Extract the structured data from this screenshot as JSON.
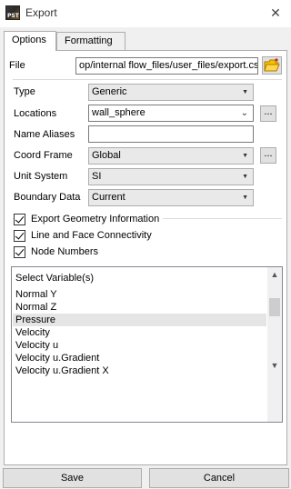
{
  "window": {
    "title": "Export",
    "icon_text": "PST",
    "close_glyph": "✕"
  },
  "tabs": [
    {
      "label": "Options",
      "active": true
    },
    {
      "label": "Formatting",
      "active": false
    }
  ],
  "file": {
    "label": "File",
    "value": "op/internal flow_files/user_files/export.csv",
    "browse_icon": "folder-open-icon"
  },
  "form": {
    "type": {
      "label": "Type",
      "value": "Generic"
    },
    "locations": {
      "label": "Locations",
      "value": "wall_sphere",
      "more_button": "..."
    },
    "name_aliases": {
      "label": "Name Aliases",
      "value": ""
    },
    "coord_frame": {
      "label": "Coord Frame",
      "value": "Global",
      "more_button": "..."
    },
    "unit_system": {
      "label": "Unit System",
      "value": "SI"
    },
    "boundary_data": {
      "label": "Boundary Data",
      "value": "Current"
    }
  },
  "checkboxes": {
    "export_geometry": {
      "label": "Export Geometry Information",
      "checked": true
    },
    "line_face": {
      "label": "Line and Face Connectivity",
      "checked": true
    },
    "node_numbers": {
      "label": "Node Numbers",
      "checked": true
    }
  },
  "variables": {
    "header": "Select Variable(s)",
    "items": [
      "Normal Y",
      "Normal Z",
      "Pressure",
      "Velocity",
      "Velocity u",
      "Velocity u.Gradient",
      "Velocity u.Gradient X"
    ],
    "selected": "Pressure"
  },
  "buttons": {
    "save": "Save",
    "cancel": "Cancel"
  },
  "colors": {
    "window_bg": "#f0f0f0",
    "panel_bg": "#ffffff",
    "selection": "#e5e5e5",
    "folder_icon": "#e8a800"
  }
}
